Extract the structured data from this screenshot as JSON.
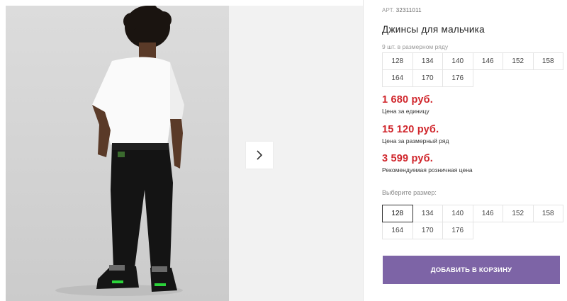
{
  "product": {
    "article_label": "АРТ.",
    "article_value": "32311011",
    "title": "Джинсы для мальчика",
    "size_series_note": "9 шт. в размерном ряду",
    "series_sizes": [
      "128",
      "134",
      "140",
      "146",
      "152",
      "158",
      "164",
      "170",
      "176"
    ]
  },
  "prices": [
    {
      "value": "1 680 руб.",
      "caption": "Цена за единицу"
    },
    {
      "value": "15 120 руб.",
      "caption": "Цена за размерный ряд"
    },
    {
      "value": "3 599 руб.",
      "caption": "Рекомендуемая розничная цена"
    }
  ],
  "size_picker": {
    "label": "Выберите размер:",
    "sizes": [
      "128",
      "134",
      "140",
      "146",
      "152",
      "158",
      "164",
      "170",
      "176"
    ],
    "selected": "128"
  },
  "cart": {
    "button_label": "ДОБАВИТЬ В КОРЗИНУ"
  },
  "colors": {
    "price": "#d0252b",
    "cart_button": "#7d64a6"
  },
  "icons": {
    "next": "chevron-right-icon"
  }
}
